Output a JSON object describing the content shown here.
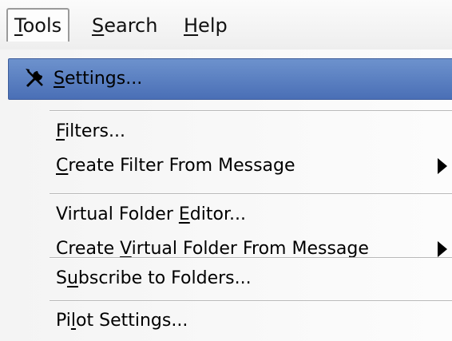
{
  "menubar": {
    "items": [
      {
        "label": "Tools",
        "mnemonic": "T",
        "rest": "ools"
      },
      {
        "label": "Search",
        "mnemonic": "S",
        "rest": "earch"
      },
      {
        "label": "Help",
        "mnemonic": "H",
        "rest": "elp"
      }
    ],
    "active": "Tools"
  },
  "menu": {
    "items": [
      {
        "pre": "",
        "mnemonic": "S",
        "post": "ettings...",
        "icon": "tools-icon",
        "highlighted": true
      },
      {
        "pre": "",
        "mnemonic": "F",
        "post": "ilters..."
      },
      {
        "pre": "",
        "mnemonic": "C",
        "post": "reate Filter From Message",
        "submenu": true
      },
      {
        "pre": "Virtual Folder ",
        "mnemonic": "E",
        "post": "ditor..."
      },
      {
        "pre": "Create ",
        "mnemonic": "V",
        "post": "irtual Folder From Message",
        "submenu": true
      },
      {
        "pre": "S",
        "mnemonic": "u",
        "post": "bscribe to Folders..."
      },
      {
        "pre": "Pi",
        "mnemonic": "l",
        "post": "ot Settings..."
      }
    ]
  },
  "colors": {
    "highlight": "#5b80c1",
    "separator": "#b8b8b8"
  }
}
